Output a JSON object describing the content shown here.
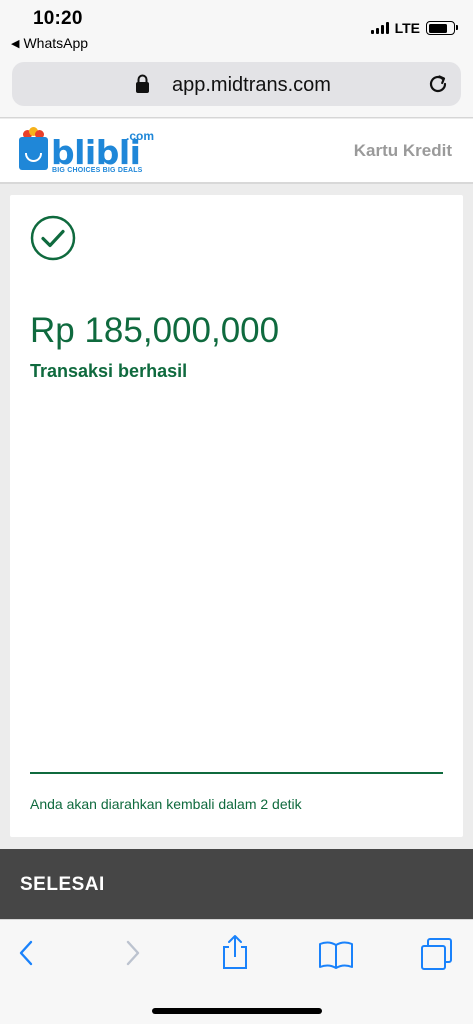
{
  "status_bar": {
    "time": "10:20",
    "back_app": "WhatsApp",
    "network": "LTE",
    "back_arrow_icon": "triangle-left-icon"
  },
  "browser": {
    "url": "app.midtrans.com",
    "lock_icon": "lock-icon",
    "reload_icon": "reload-icon"
  },
  "header": {
    "logo_text": "blibli",
    "logo_suffix": ".com",
    "logo_tagline": "BIG CHOICES  BIG DEALS",
    "title": "Kartu Kredit"
  },
  "result": {
    "icon": "check-circle-icon",
    "amount": "Rp 185,000,000",
    "status": "Transaksi berhasil",
    "redirect_message": "Anda akan diarahkan kembali dalam 2 detik"
  },
  "footer": {
    "done_label": "SELESAI"
  },
  "toolbar": {
    "items": [
      "back-icon",
      "forward-icon",
      "share-icon",
      "bookmarks-icon",
      "tabs-icon"
    ]
  },
  "colors": {
    "success_green": "#0f6a3e",
    "brand_blue": "#1f87d8",
    "ios_blue": "#1a82fb",
    "done_bar": "#464646"
  }
}
